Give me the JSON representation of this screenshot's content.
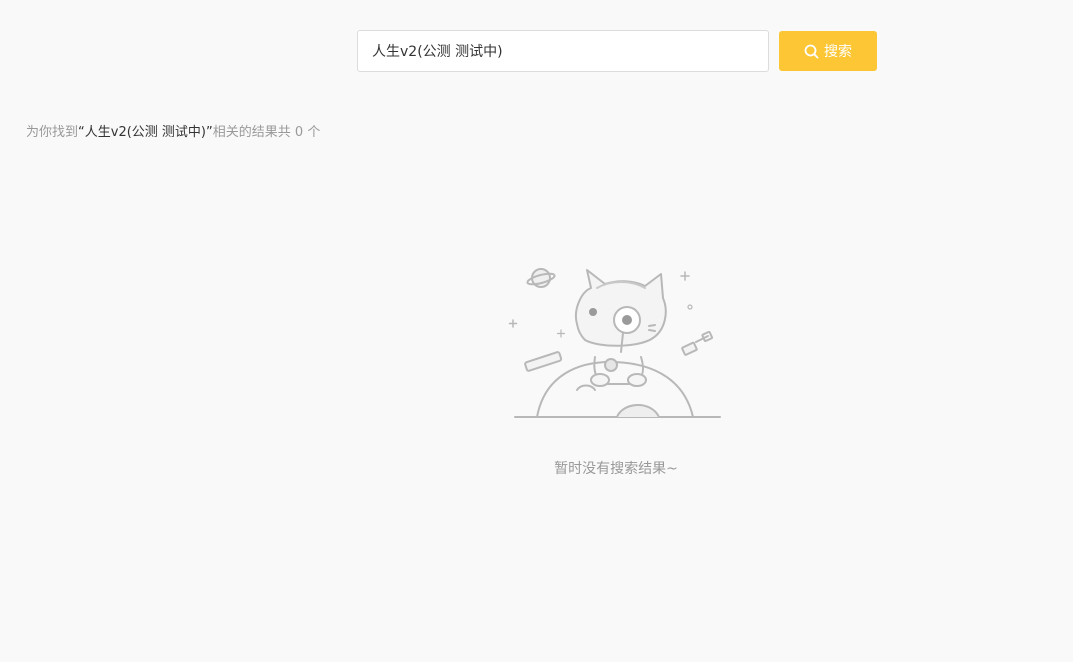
{
  "search": {
    "value": "人生v2(公测 测试中)",
    "button_label": "搜索",
    "button_icon": "search-icon",
    "button_color": "#fcc635"
  },
  "summary": {
    "prefix": "为你找到",
    "open_quote": "“",
    "keyword": "人生v2(公测 测试中)",
    "close_quote": "”",
    "middle": "相关的结果共",
    "count": "0",
    "suffix": "个"
  },
  "empty_state": {
    "illustration": "cat-with-magnifier-on-planet",
    "message": "暂时没有搜索结果~"
  }
}
